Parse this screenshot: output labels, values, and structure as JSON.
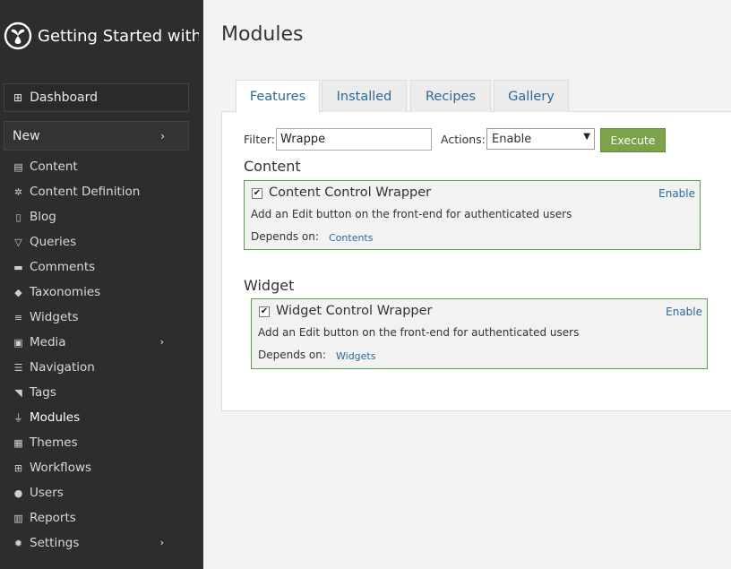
{
  "sidebar": {
    "brand_title": "Getting Started with ...",
    "dashboard_label": "Dashboard",
    "new_label": "New",
    "items": [
      {
        "label": "Content",
        "icon": "file-icon"
      },
      {
        "label": "Content Definition",
        "icon": "puzzle-icon"
      },
      {
        "label": "Blog",
        "icon": "book-icon"
      },
      {
        "label": "Queries",
        "icon": "filter-icon"
      },
      {
        "label": "Comments",
        "icon": "comment-icon"
      },
      {
        "label": "Taxonomies",
        "icon": "tags-icon"
      },
      {
        "label": "Widgets",
        "icon": "list-icon"
      },
      {
        "label": "Media",
        "icon": "image-icon"
      },
      {
        "label": "Navigation",
        "icon": "list-icon"
      },
      {
        "label": "Tags",
        "icon": "tag-icon"
      },
      {
        "label": "Modules",
        "icon": "plug-icon"
      },
      {
        "label": "Themes",
        "icon": "grid-icon"
      },
      {
        "label": "Workflows",
        "icon": "sitemap-icon"
      },
      {
        "label": "Users",
        "icon": "user-icon"
      },
      {
        "label": "Reports",
        "icon": "chart-icon"
      },
      {
        "label": "Settings",
        "icon": "gear-icon"
      }
    ],
    "active_item": "Modules"
  },
  "main": {
    "title": "Modules",
    "tabs": [
      {
        "label": "Features"
      },
      {
        "label": "Installed"
      },
      {
        "label": "Recipes"
      },
      {
        "label": "Gallery"
      }
    ],
    "active_tab": "Features",
    "filter": {
      "label": "Filter:",
      "value": "Wrappe"
    },
    "actions": {
      "label": "Actions:",
      "selected": "Enable",
      "execute_label": "Execute"
    },
    "sections": [
      {
        "title": "Content",
        "features": [
          {
            "name": "Content Control Wrapper",
            "enable_label": "Enable",
            "description": "Add an Edit button on the front-end for authenticated users",
            "depends_label": "Depends on:",
            "depends": "Contents",
            "checked": true
          }
        ]
      },
      {
        "title": "Widget",
        "features": [
          {
            "name": "Widget Control Wrapper",
            "enable_label": "Enable",
            "description": "Add an Edit button on the front-end for authenticated users",
            "depends_label": "Depends on:",
            "depends": "Widgets",
            "checked": true
          }
        ]
      }
    ]
  },
  "colors": {
    "sidebar_bg": "#2d2d2d",
    "accent_link": "#2c6a95",
    "execute_green": "#7aa34a",
    "feature_border": "#5aa04a"
  }
}
